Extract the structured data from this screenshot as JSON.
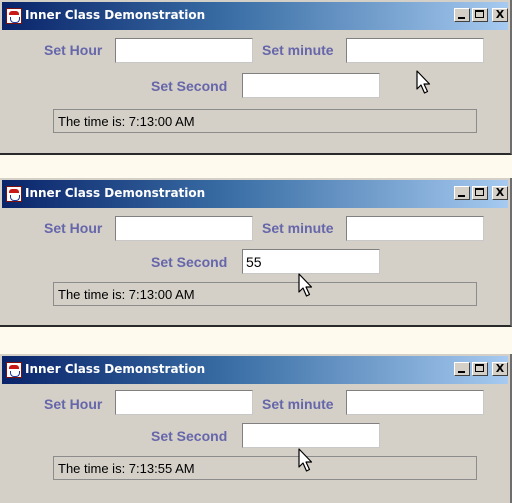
{
  "windows": [
    {
      "title": "Inner Class Demonstration",
      "hour_label": "Set Hour",
      "hour_value": "",
      "minute_label": "Set minute",
      "minute_value": "",
      "second_label": "Set Second",
      "second_value": "",
      "status_text": "The time is: 7:13:00 AM"
    },
    {
      "title": "Inner Class Demonstration",
      "hour_label": "Set Hour",
      "hour_value": "",
      "minute_label": "Set minute",
      "minute_value": "",
      "second_label": "Set Second",
      "second_value": "55",
      "status_text": "The time is: 7:13:00 AM"
    },
    {
      "title": "Inner Class Demonstration",
      "hour_label": "Set Hour",
      "hour_value": "",
      "minute_label": "Set minute",
      "minute_value": "",
      "second_label": "Set Second",
      "second_value": "",
      "status_text": "The time is: 7:13:55 AM"
    }
  ],
  "titlebar_buttons": {
    "close_glyph": "X"
  },
  "icons": [
    "java-app-icon",
    "minimize-icon",
    "maximize-icon",
    "close-icon",
    "mouse-pointer-icon"
  ],
  "colors": {
    "background": "#fffaee",
    "window": "#d4d0c8",
    "titlebar_start": "#0a246a",
    "titlebar_end": "#a6caf0",
    "label": "#6666aa"
  }
}
